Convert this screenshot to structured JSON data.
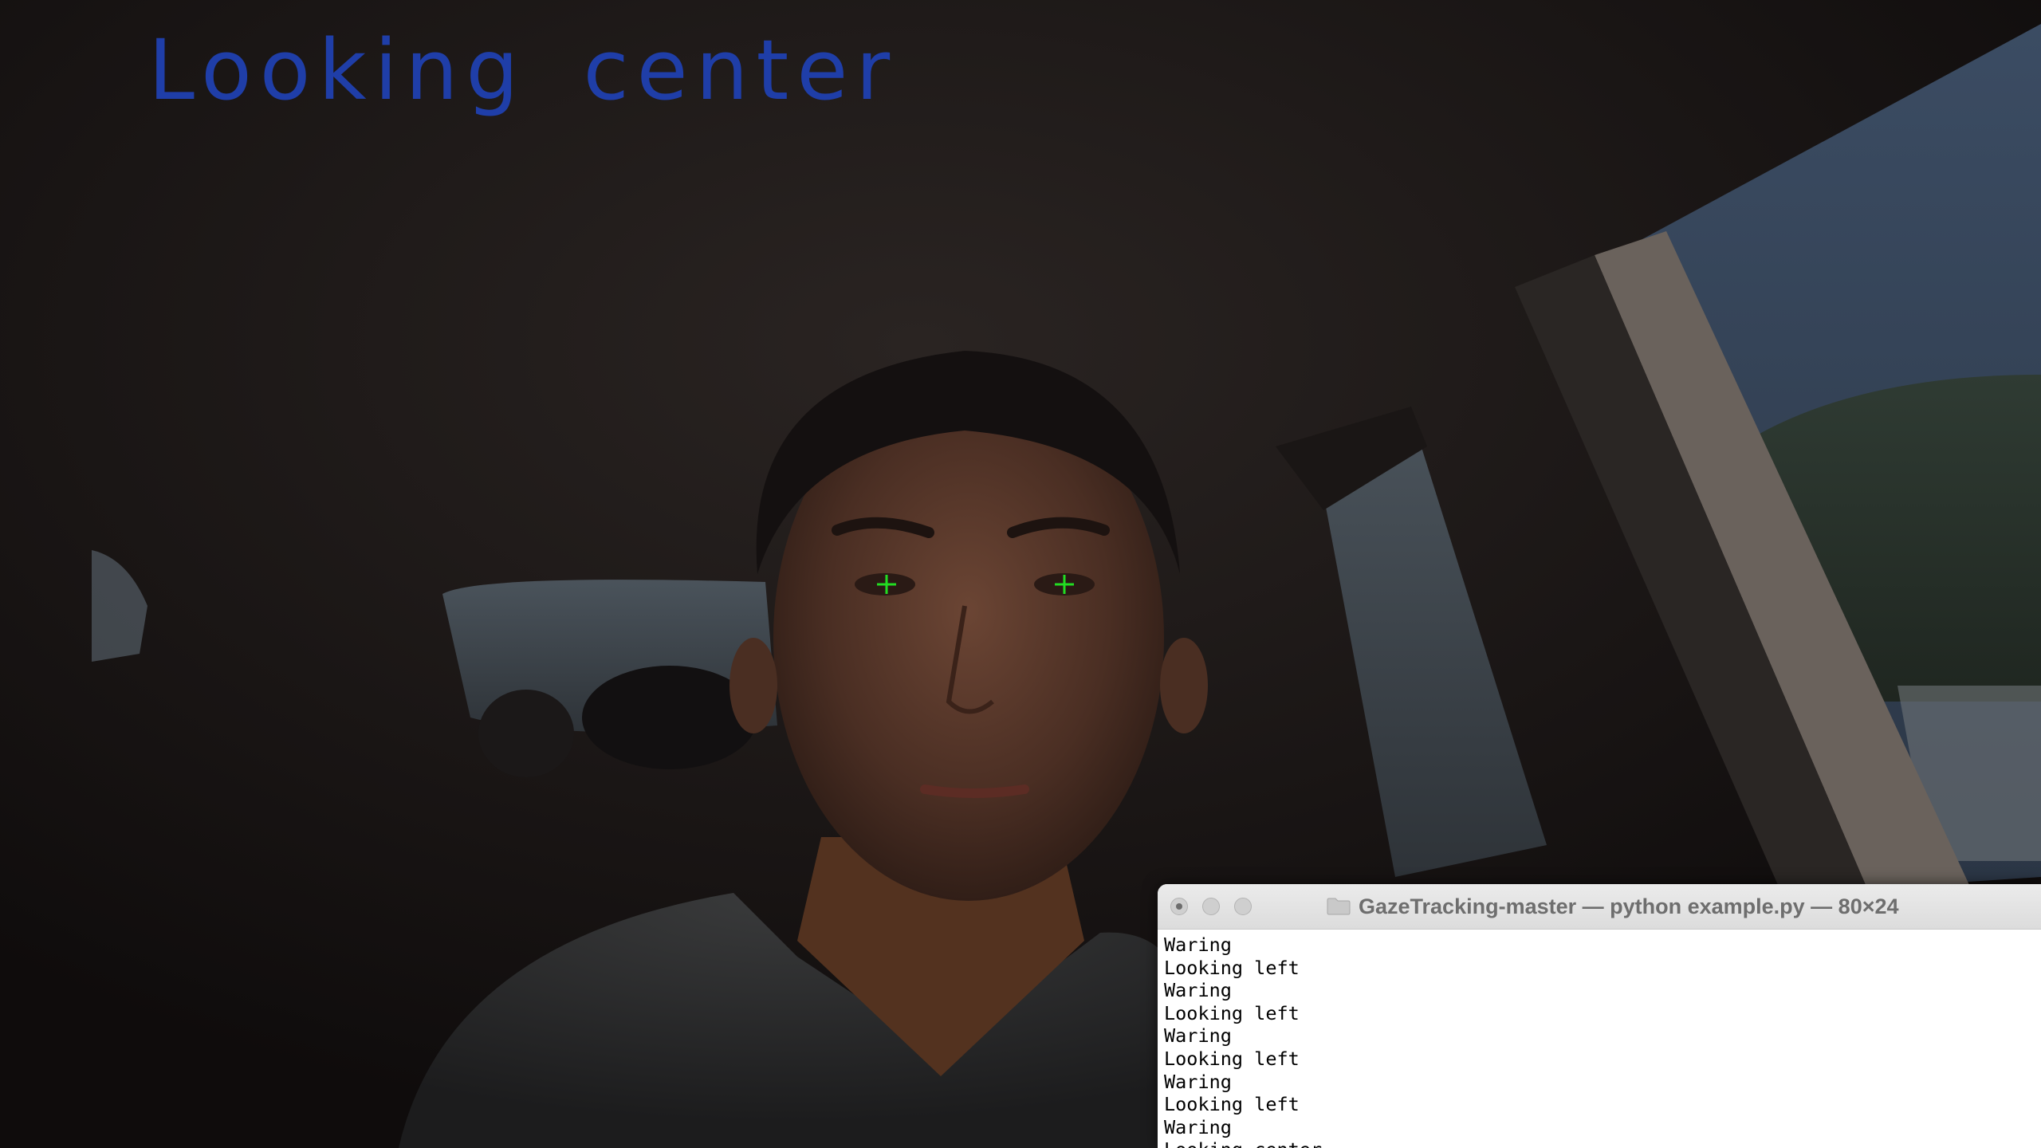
{
  "overlay": {
    "gaze_label": "Looking center",
    "gaze_label_color": "#1f3ea8",
    "pupil_marker_color": "#22dd22"
  },
  "terminal": {
    "title": "GazeTracking-master — python example.py — 80×24",
    "lines": [
      "Waring",
      "Looking left",
      "Waring",
      "Looking left",
      "Waring",
      "Looking left",
      "Waring",
      "Looking left",
      "Waring",
      "Looking center"
    ],
    "icons": {
      "close": "close-icon",
      "minimize": "minimize-icon",
      "zoom": "zoom-icon",
      "folder": "folder-icon"
    }
  }
}
